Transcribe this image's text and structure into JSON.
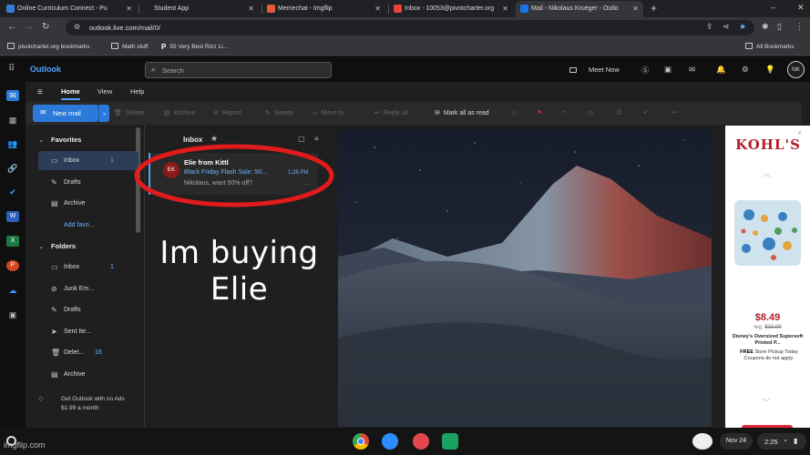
{
  "browser": {
    "tabs": [
      {
        "title": "Online Curriculum Connect - Pu",
        "favicon_color": "#3a7bd5",
        "active": false
      },
      {
        "title": "Student App",
        "favicon_color": "",
        "active": false
      },
      {
        "title": "Memechat - Imgflip",
        "favicon_color": "#e35b3d",
        "active": false
      },
      {
        "title": "Inbox - 10053@pivotcharter.org",
        "favicon_color": "#ea4335",
        "active": false
      },
      {
        "title": "Mail - Nikolaus Krueger - Outlo",
        "favicon_color": "#1a73e8",
        "active": true
      }
    ],
    "new_tab_glyph": "+",
    "close_glyph": "✕",
    "url": "outlook.live.com/mail/0/",
    "bookmarks": [
      {
        "label": "pivotcharter.org bookmarks",
        "icon": "folder-icon"
      },
      {
        "label": "Math stuff",
        "icon": "folder-icon"
      },
      {
        "label": "55 Very Best Rizz Li...",
        "icon": "p-logo-icon"
      }
    ],
    "all_bookmarks": "All Bookmarks"
  },
  "outlook": {
    "brand": "Outlook",
    "search_placeholder": "Search",
    "meet_now": "Meet Now",
    "avatar_initials": "NK",
    "ribbon_tabs": [
      "Home",
      "View",
      "Help"
    ],
    "new_mail_label": "New mail",
    "ribbon_actions": [
      {
        "label": "Delete",
        "icon": "trash-icon",
        "enabled": false
      },
      {
        "label": "Archive",
        "icon": "archive-icon",
        "enabled": false
      },
      {
        "label": "Report",
        "icon": "report-icon",
        "enabled": false
      },
      {
        "label": "Sweep",
        "icon": "broom-icon",
        "enabled": false
      },
      {
        "label": "Move to",
        "icon": "folder-move-icon",
        "enabled": false
      },
      {
        "label": "Reply all",
        "icon": "reply-all-icon",
        "enabled": false
      },
      {
        "label": "Mark all as read",
        "icon": "envelope-open-icon",
        "enabled": true
      }
    ],
    "accent_color": "#2b7ad9",
    "folders": {
      "favorites_label": "Favorites",
      "favorites": [
        {
          "label": "Inbox",
          "count": "1",
          "icon": "inbox-icon",
          "selected": true
        },
        {
          "label": "Drafts",
          "count": "",
          "icon": "pencil-icon"
        },
        {
          "label": "Archive",
          "count": "",
          "icon": "archive-icon"
        },
        {
          "label": "Add favo...",
          "count": "",
          "icon": ""
        }
      ],
      "folders_label": "Folders",
      "items": [
        {
          "label": "Inbox",
          "count": "1",
          "icon": "inbox-icon"
        },
        {
          "label": "Junk Em...",
          "count": "",
          "icon": "junk-icon"
        },
        {
          "label": "Drafts",
          "count": "",
          "icon": "pencil-icon"
        },
        {
          "label": "Sent Ite...",
          "count": "",
          "icon": "send-icon"
        },
        {
          "label": "Delet...",
          "count": "16",
          "icon": "trash-icon"
        },
        {
          "label": "Archive",
          "count": "",
          "icon": "archive-icon"
        }
      ],
      "promo": "Get Outlook with no Ads $1.99 a month"
    },
    "message_list": {
      "title": "Inbox",
      "messages": [
        {
          "avatar": "EK",
          "sender": "Elie from Kittl",
          "subject": "Black Friday Flash Sale: 50...",
          "time": "1:26 PM",
          "preview": "Nikolaus, want 50% off?"
        }
      ]
    }
  },
  "ad": {
    "brand": "KOHL'S",
    "price": "$8.49",
    "reg_prefix": "reg.",
    "reg_price": "$19.99",
    "title": "Disney's Oversized Supersoft Printed P...",
    "free_label": "FREE",
    "pickup": "Store Pickup Today",
    "coupons": "Coupons do not apply.",
    "brand_color": "#b21f2d"
  },
  "meme": {
    "caption": "Im buying Elie",
    "watermark": "imgflip.com",
    "highlight_color": "#e01b1b"
  },
  "taskbar": {
    "date": "Nov 24",
    "time": "2:25"
  }
}
